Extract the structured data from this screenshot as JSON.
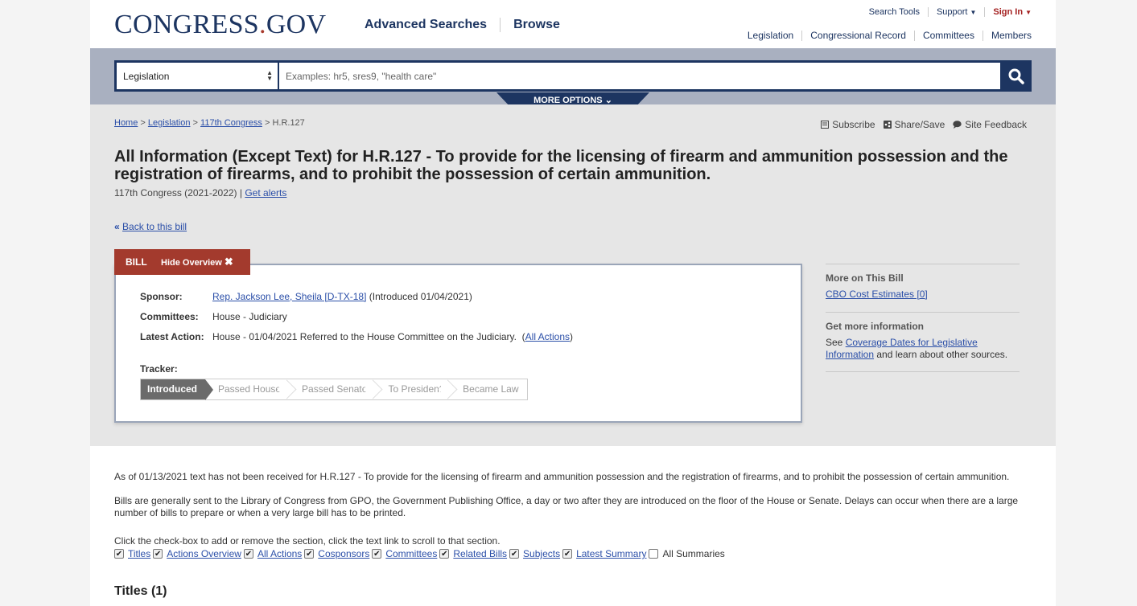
{
  "header": {
    "logo_main": "CONGRESS",
    "logo_dot": ".",
    "logo_gov": "GOV",
    "nav": [
      "Advanced Searches",
      "Browse"
    ],
    "utility": {
      "search_tools": "Search Tools",
      "support": "Support",
      "sign_in": "Sign In"
    },
    "subnav": [
      "Legislation",
      "Congressional Record",
      "Committees",
      "Members"
    ]
  },
  "search": {
    "scope": "Legislation",
    "placeholder": "Examples: hr5, sres9, \"health care\"",
    "more_options": "MORE OPTIONS"
  },
  "breadcrumb": {
    "home": "Home",
    "legislation": "Legislation",
    "congress": "117th Congress",
    "current": "H.R.127"
  },
  "tools": {
    "subscribe": "Subscribe",
    "share": "Share/Save",
    "feedback": "Site Feedback"
  },
  "bill": {
    "title": "All Information (Except Text) for H.R.127 - To provide for the licensing of firearm and ammunition possession and the registration of firearms, and to prohibit the possession of certain ammunition.",
    "congress": "117th Congress (2021-2022) |",
    "get_alerts": "Get alerts",
    "back_link": "Back to this bill"
  },
  "overview": {
    "tab_label": "BILL",
    "hide_label": "Hide Overview",
    "sponsor_label": "Sponsor:",
    "sponsor_name": "Rep. Jackson Lee, Sheila [D-TX-18]",
    "sponsor_intro": " (Introduced 01/04/2021)",
    "committees_label": "Committees:",
    "committees_value": "House - Judiciary",
    "latest_label": "Latest Action:",
    "latest_value": "House - 01/04/2021 Referred to the House Committee on the Judiciary.  (",
    "all_actions": "All Actions",
    "latest_close": ")",
    "tracker_label": "Tracker:",
    "tracker_steps": [
      "Introduced",
      "Passed House",
      "Passed Senate",
      "To President",
      "Became Law"
    ]
  },
  "sidebar": {
    "more_heading": "More on This Bill",
    "cbo_link": "CBO Cost Estimates [0]",
    "info_heading": "Get more information",
    "see": "See ",
    "coverage_link": "Coverage Dates for Legislative Information",
    "info_tail": " and learn about other sources."
  },
  "body": {
    "notice": "As of 01/13/2021 text has not been received for H.R.127 - To provide for the licensing of firearm and ammunition possession and the registration of firearms, and to prohibit the possession of certain ammunition.",
    "gpo_note": "Bills are generally sent to the Library of Congress from GPO, the Government Publishing Office, a day or two after they are introduced on the floor of the House or Senate. Delays can occur when there are a large number of bills to prepare or when a very large bill has to be printed.",
    "instructions": "Click the check-box to add or remove the section, click the text link to scroll to that section.",
    "sections": [
      {
        "label": "Titles",
        "checked": true
      },
      {
        "label": "Actions Overview",
        "checked": true
      },
      {
        "label": "All Actions",
        "checked": true
      },
      {
        "label": "Cosponsors",
        "checked": true
      },
      {
        "label": "Committees",
        "checked": true
      },
      {
        "label": "Related Bills",
        "checked": true
      },
      {
        "label": "Subjects",
        "checked": true
      },
      {
        "label": "Latest Summary",
        "checked": true
      },
      {
        "label": "All Summaries",
        "checked": false
      }
    ],
    "titles_heading": "Titles (1)"
  },
  "colors": {
    "navy": "#1d3561",
    "brand_red": "#a83a2d",
    "link": "#2b4fa8",
    "band": "#a9b0c0"
  }
}
